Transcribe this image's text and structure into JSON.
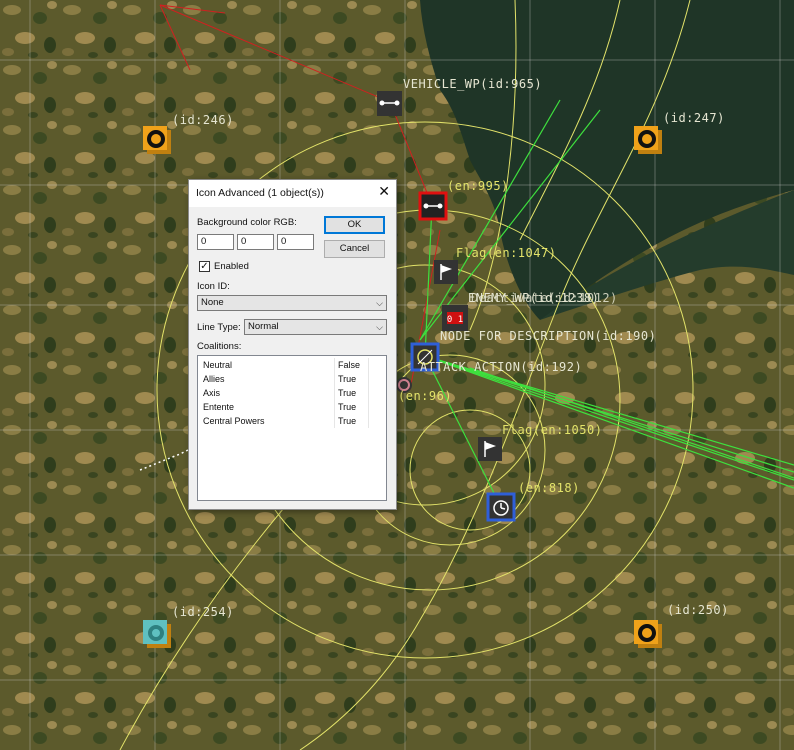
{
  "map": {
    "labels": {
      "vehicle_wp": "VEHICLE_WP(id:965)",
      "id246": "(id:246)",
      "id247": "(id:247)",
      "en995": "(en:995)",
      "flag1047": "Flag(en:1047)",
      "enemy_overlap": "ENEMY_WP(id:1238)",
      "deactivate_overlap": "Deactivate(id:1012)",
      "node_desc": "NODE FOR DESCRIPTION(id:190)",
      "attack_action": "ATTACK ACTION(id:192)",
      "en_small": "(en:96)",
      "flag1050": "Flag(en:1050)",
      "en818": "(en:818)",
      "id254": "(id:254)",
      "id250": "(id:250)",
      "counter": "0 1"
    },
    "colors": {
      "ground": "#5c5a2c",
      "water": "#1e3428",
      "orange_icon": "#f0a21a",
      "teal_icon": "#5fc0c0",
      "red_select": "#e01010",
      "blue_select": "#2f5fd8",
      "yellow_line": "#e3e36a",
      "green_line": "#3ee03e"
    },
    "icons": [
      "vehicle-waypoint-icon",
      "object-orange-icon",
      "flag-icon",
      "timer-icon",
      "gear-icon",
      "counter-icon"
    ]
  },
  "dialog": {
    "title": "Icon Advanced (1 object(s))",
    "close_glyph": "✕",
    "bg_color_label": "Background color RGB:",
    "rgb_r": "0",
    "rgb_g": "0",
    "rgb_b": "0",
    "ok_label": "OK",
    "cancel_label": "Cancel",
    "enabled_label": "Enabled",
    "enabled_check": "✓",
    "icon_id_label": "Icon ID:",
    "icon_id_value": "None",
    "line_type_label": "Line Type:",
    "line_type_value": "Normal",
    "coalitions_label": "Coalitions:",
    "combo_arrow": "⌵",
    "coalitions": [
      {
        "name": "Neutral",
        "value": "False"
      },
      {
        "name": "Allies",
        "value": "True"
      },
      {
        "name": "Axis",
        "value": "True"
      },
      {
        "name": "Entente",
        "value": "True"
      },
      {
        "name": "Central Powers",
        "value": "True"
      }
    ]
  }
}
